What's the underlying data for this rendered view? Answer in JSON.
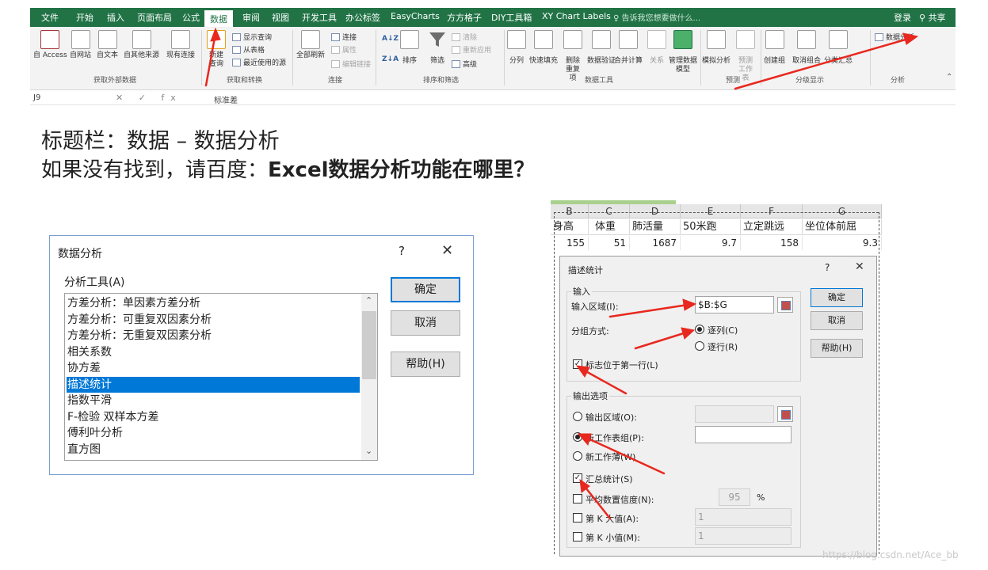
{
  "ribbon": {
    "tabs": [
      "文件",
      "开始",
      "插入",
      "页面布局",
      "公式",
      "数据",
      "审阅",
      "视图",
      "开发工具",
      "办公标签",
      "EasyCharts",
      "方方格子",
      "DIY工具箱",
      "XY Chart Labels"
    ],
    "active_tab": "数据",
    "tell_me": "告诉我您想要做什么...",
    "login": "登录",
    "share": "共享",
    "get_external": {
      "access": "自 Access",
      "web": "自网站",
      "text": "自文本",
      "other": "自其他来源",
      "existing": "现有连接",
      "label": "获取外部数据"
    },
    "transform": {
      "new_query": "新建查询",
      "show_queries": "显示查询",
      "from_table": "从表格",
      "recent_sources": "最近使用的源",
      "label": "获取和转换"
    },
    "connections": {
      "refresh_all": "全部刷新",
      "connections": "连接",
      "properties": "属性",
      "edit_links": "编辑链接",
      "label": "连接"
    },
    "sort_filter": {
      "sort": "排序",
      "filter": "筛选",
      "clear": "清除",
      "reapply": "重新应用",
      "advanced": "高级",
      "label": "排序和筛选"
    },
    "data_tools": {
      "text_to_columns": "分列",
      "flash_fill": "快速填充",
      "remove_duplicates": "删除重复项",
      "data_validation": "数据验证",
      "consolidate": "合并计算",
      "relationships": "关系",
      "manage_model": "管理数据模型",
      "label": "数据工具"
    },
    "forecast": {
      "what_if": "模拟分析",
      "forecast_sheet": "预测工作表",
      "label": "预测"
    },
    "outline": {
      "group": "创建组",
      "ungroup": "取消组合",
      "subtotal": "分类汇总",
      "label": "分级显示"
    },
    "analysis": {
      "data_analysis": "数据分析",
      "label": "分析"
    }
  },
  "formula_bar": {
    "cell": "J9",
    "icons": "✕ ✓ fx",
    "value": "标准差"
  },
  "heading": {
    "line1": "标题栏：数据 – 数据分析",
    "line2_prefix": "如果没有找到，请百度：",
    "line2_bold": "Excel数据分析功能在哪里？"
  },
  "data_analysis_dialog": {
    "title": "数据分析",
    "help_icon": "?",
    "tools_label": "分析工具(A)",
    "items": [
      "方差分析：单因素方差分析",
      "方差分析：可重复双因素分析",
      "方差分析：无重复双因素分析",
      "相关系数",
      "协方差",
      "描述统计",
      "指数平滑",
      "F-检验 双样本方差",
      "傅利叶分析",
      "直方图"
    ],
    "selected_index": 5,
    "ok": "确定",
    "cancel": "取消",
    "help": "帮助(H)"
  },
  "sheet": {
    "columns": [
      "B",
      "C",
      "D",
      "E",
      "F",
      "G"
    ],
    "headers": [
      "身高",
      "体重",
      "肺活量",
      "50米跑",
      "立定跳远",
      "坐位体前屈"
    ],
    "row1": [
      "155",
      "51",
      "1687",
      "9.7",
      "158",
      "9.3"
    ]
  },
  "descriptive_stats_dialog": {
    "title": "描述统计",
    "help_icon": "?",
    "input_section": "输入",
    "input_range_label": "输入区域(I):",
    "input_range_value": "$B:$G",
    "grouped_by_label": "分组方式:",
    "by_columns": "逐列(C)",
    "by_rows": "逐行(R)",
    "labels_first_row": "标志位于第一行(L)",
    "output_section": "输出选项",
    "output_range": "输出区域(O):",
    "new_sheet": "新工作表组(P):",
    "new_workbook": "新工作薄(W)",
    "summary_stats": "汇总统计(S)",
    "confidence_level": "平均数置信度(N):",
    "confidence_value": "95",
    "percent": "%",
    "kth_largest": "第 K 大值(A):",
    "kth_largest_value": "1",
    "kth_smallest": "第 K 小值(M):",
    "kth_smallest_value": "1",
    "ok": "确定",
    "cancel": "取消",
    "help": "帮助(H)"
  },
  "watermark": "https://blog.csdn.net/Ace_bb",
  "colors": {
    "excel_green": "#217346",
    "selection_blue": "#0078d7",
    "annotation_red": "#e8281e"
  }
}
